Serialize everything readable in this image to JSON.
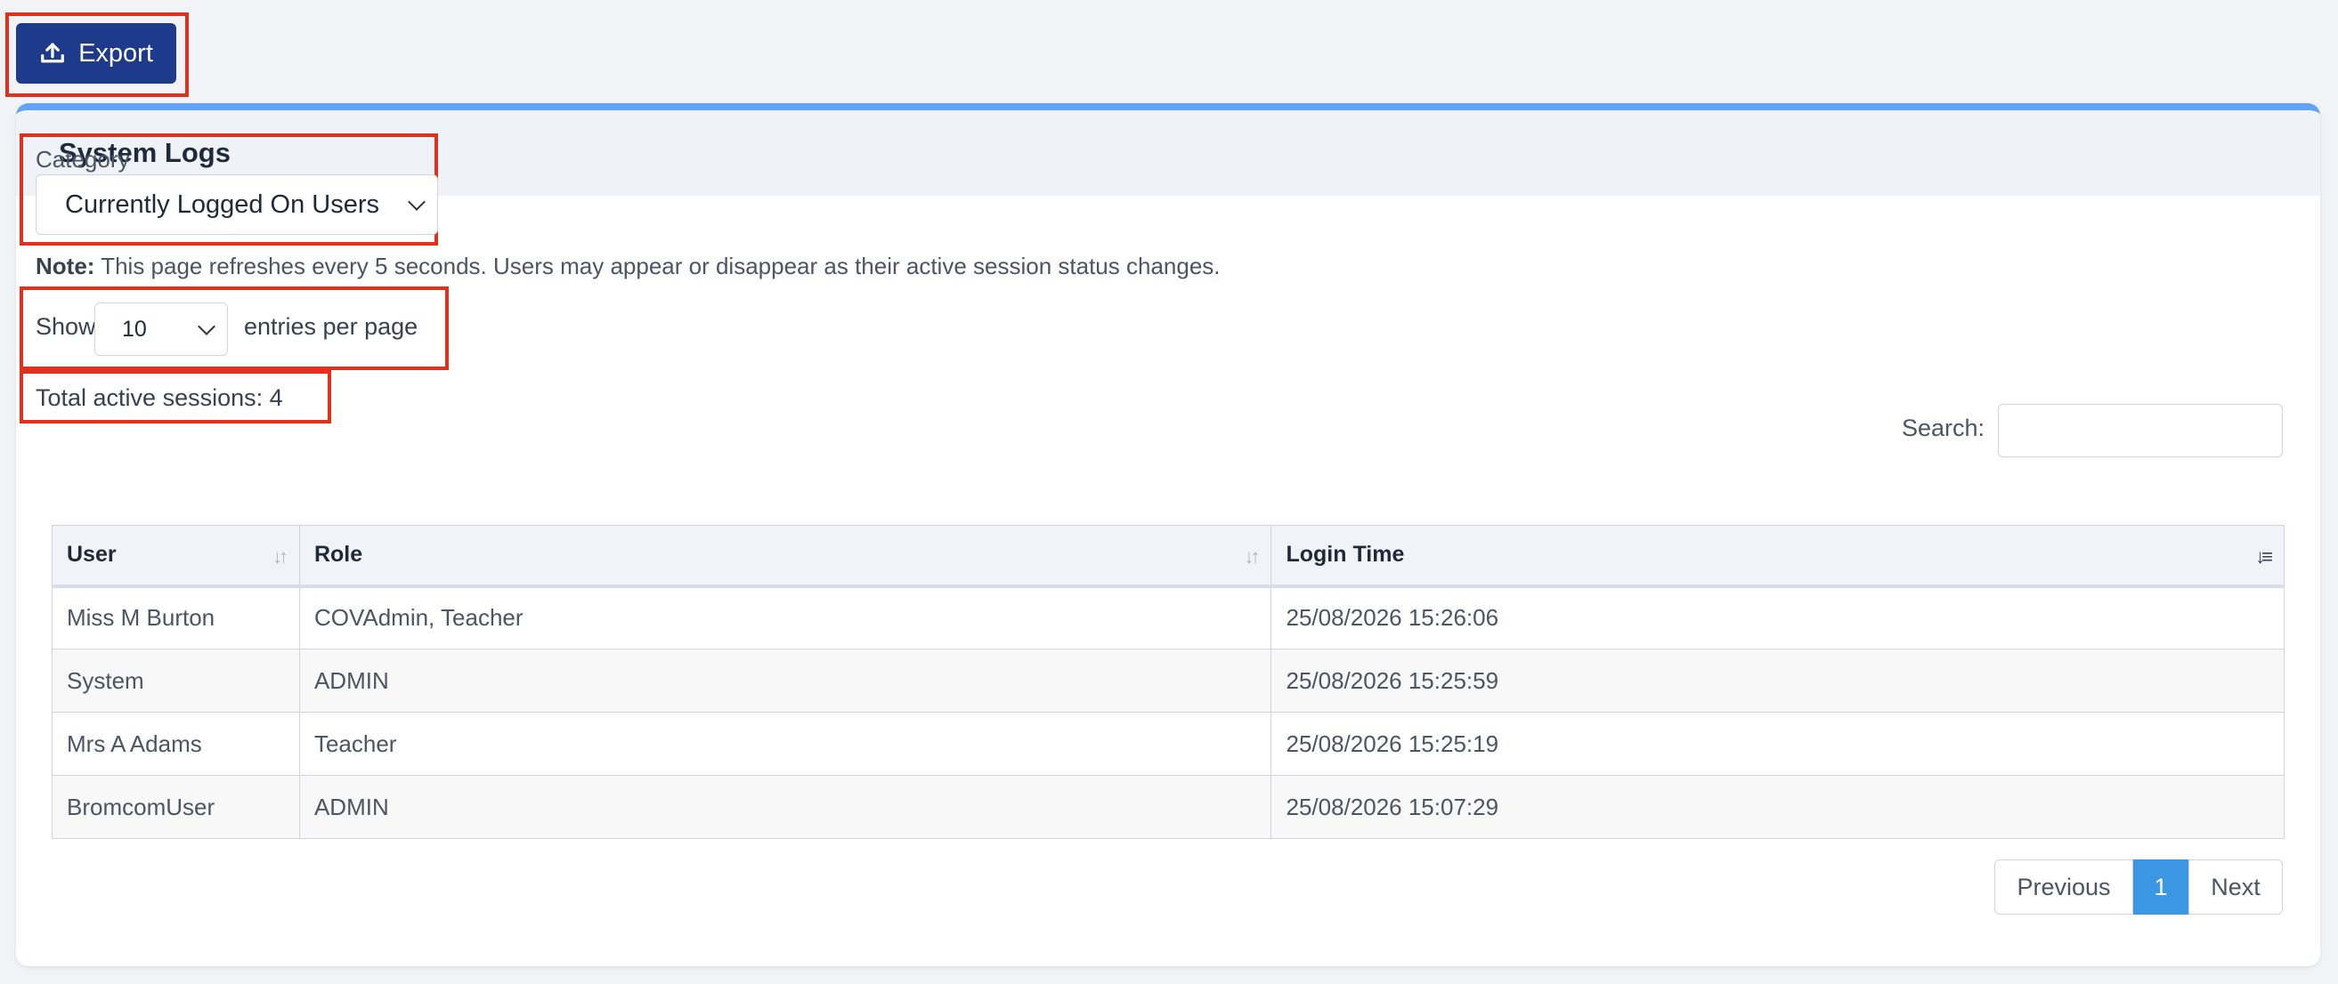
{
  "toolbar": {
    "export_label": "Export"
  },
  "card": {
    "title": "System Logs"
  },
  "category": {
    "label": "Category",
    "selected": "Currently Logged On Users"
  },
  "note": {
    "prefix": "Note:",
    "text": "This page refreshes every 5 seconds. Users may appear or disappear as their active session status changes."
  },
  "entries": {
    "show_label": "Show",
    "value": "10",
    "suffix_label": "entries per page"
  },
  "search": {
    "label": "Search:",
    "value": ""
  },
  "sessions": {
    "total_text": "Total active sessions: 4"
  },
  "table": {
    "columns": [
      "User",
      "Role",
      "Login Time"
    ],
    "rows": [
      [
        "Miss M Burton",
        "COVAdmin, Teacher",
        "25/08/2026 15:26:06"
      ],
      [
        "System",
        "ADMIN",
        "25/08/2026 15:25:59"
      ],
      [
        "Mrs A Adams",
        "Teacher",
        "25/08/2026 15:25:19"
      ],
      [
        "BromcomUser",
        "ADMIN",
        "25/08/2026 15:07:29"
      ]
    ]
  },
  "pagination": {
    "previous": "Previous",
    "current": "1",
    "next": "Next"
  },
  "colors": {
    "primary": "#1e3a8a",
    "accent": "#60a5fa",
    "page_active": "#3b96e3",
    "highlight": "#e0301e"
  }
}
